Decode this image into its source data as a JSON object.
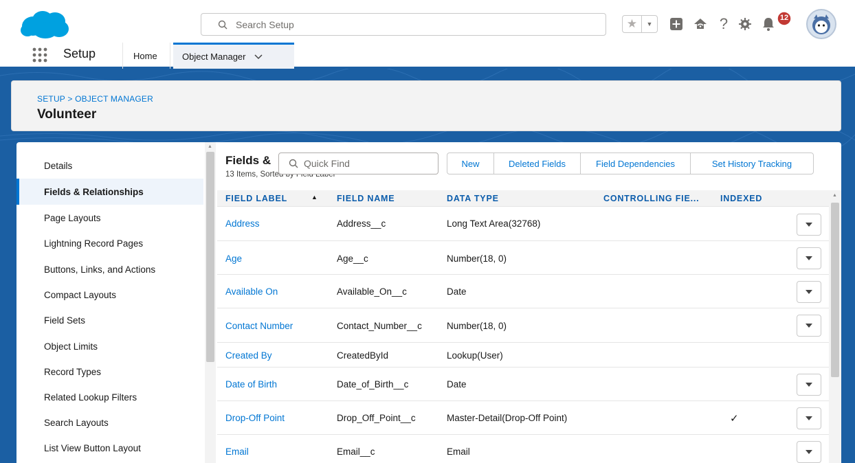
{
  "header": {
    "search_placeholder": "Search Setup",
    "notification_count": "12"
  },
  "app_nav": {
    "app_name": "Setup",
    "tabs": [
      {
        "label": "Home"
      },
      {
        "label": "Object Manager"
      }
    ]
  },
  "page": {
    "breadcrumb": "SETUP > OBJECT MANAGER",
    "title": "Volunteer"
  },
  "sidebar": {
    "items": [
      {
        "label": "Details"
      },
      {
        "label": "Fields & Relationships"
      },
      {
        "label": "Page Layouts"
      },
      {
        "label": "Lightning Record Pages"
      },
      {
        "label": "Buttons, Links, and Actions"
      },
      {
        "label": "Compact Layouts"
      },
      {
        "label": "Field Sets"
      },
      {
        "label": "Object Limits"
      },
      {
        "label": "Record Types"
      },
      {
        "label": "Related Lookup Filters"
      },
      {
        "label": "Search Layouts"
      },
      {
        "label": "List View Button Layout"
      }
    ]
  },
  "fields": {
    "title": "Fields &",
    "subtitle": "13 Items, Sorted by Field Label",
    "quick_find_placeholder": "Quick Find",
    "buttons": {
      "new": "New",
      "deleted": "Deleted Fields",
      "dependencies": "Field Dependencies",
      "history": "Set History Tracking"
    },
    "columns": {
      "label": "FIELD LABEL",
      "name": "FIELD NAME",
      "type": "DATA TYPE",
      "controlling": "CONTROLLING FIE...",
      "indexed": "INDEXED"
    },
    "rows": [
      {
        "label": "Address",
        "name": "Address__c",
        "type": "Long Text Area(32768)",
        "indexed": ""
      },
      {
        "label": "Age",
        "name": "Age__c",
        "type": "Number(18, 0)",
        "indexed": ""
      },
      {
        "label": "Available On",
        "name": "Available_On__c",
        "type": "Date",
        "indexed": ""
      },
      {
        "label": "Contact Number",
        "name": "Contact_Number__c",
        "type": "Number(18, 0)",
        "indexed": ""
      },
      {
        "label": "Created By",
        "name": "CreatedById",
        "type": "Lookup(User)",
        "indexed": ""
      },
      {
        "label": "Date of Birth",
        "name": "Date_of_Birth__c",
        "type": "Date",
        "indexed": ""
      },
      {
        "label": "Drop-Off Point",
        "name": "Drop_Off_Point__c",
        "type": "Master-Detail(Drop-Off Point)",
        "indexed": "✓"
      },
      {
        "label": "Email",
        "name": "Email__c",
        "type": "Email",
        "indexed": ""
      }
    ]
  },
  "colors": {
    "brand_blue": "#0176d3",
    "banner_blue": "#1b5fa3",
    "cloud_blue": "#00a1e0",
    "badge_red": "#c23934"
  }
}
